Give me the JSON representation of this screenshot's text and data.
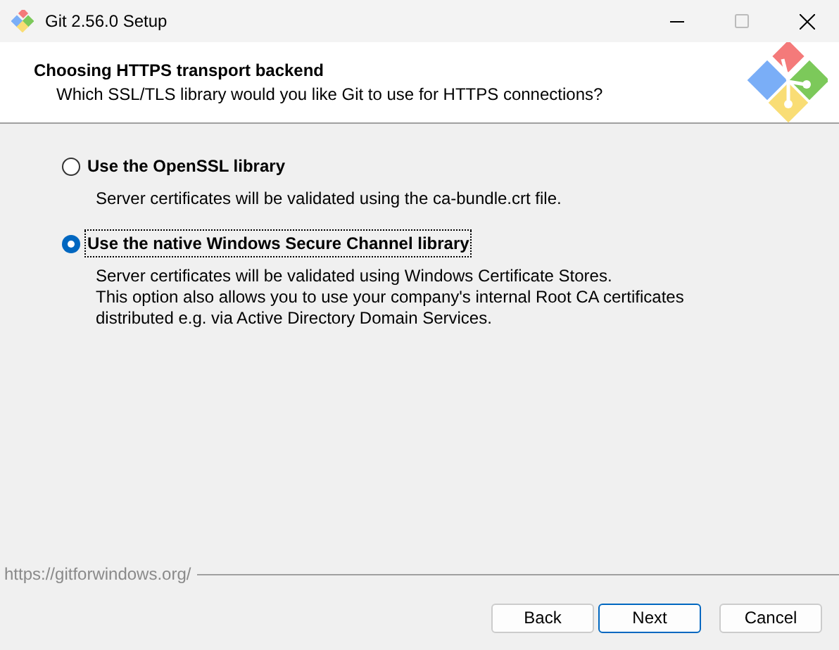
{
  "window": {
    "title": "Git 2.56.0 Setup"
  },
  "header": {
    "title": "Choosing HTTPS transport backend",
    "subtitle": "Which SSL/TLS library would you like Git to use for HTTPS connections?"
  },
  "options": [
    {
      "label": "Use the OpenSSL library",
      "selected": false,
      "description": [
        "Server certificates will be validated using the ca-bundle.crt file."
      ]
    },
    {
      "label": "Use the native Windows Secure Channel library",
      "selected": true,
      "description": [
        "Server certificates will be validated using Windows Certificate Stores.",
        "This option also allows you to use your company's internal Root CA certificates",
        "distributed e.g. via Active Directory Domain Services."
      ]
    }
  ],
  "footer": {
    "link": "https://gitforwindows.org/"
  },
  "buttons": [
    {
      "label": "Back",
      "default": false
    },
    {
      "label": "Next",
      "default": true
    },
    {
      "label": "Cancel",
      "default": false
    }
  ]
}
